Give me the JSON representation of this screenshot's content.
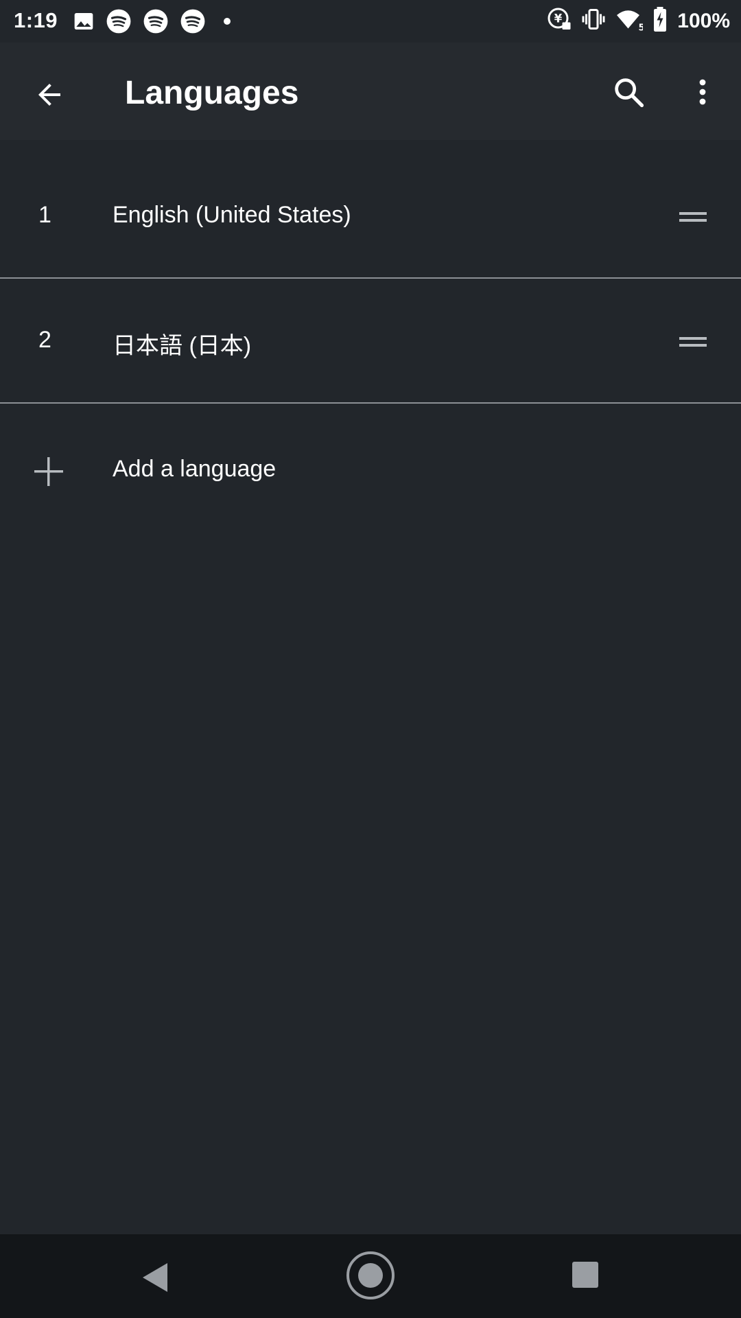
{
  "status_bar": {
    "time": "1:19",
    "battery": "100%",
    "left_icons": [
      "image-icon",
      "spotify-icon",
      "spotify-icon",
      "spotify-icon",
      "dot-icon"
    ],
    "right_icons": [
      "data-saver-icon",
      "vibrate-icon",
      "wifi-icon",
      "battery-charging-icon"
    ]
  },
  "app_bar": {
    "title": "Languages",
    "back_icon": "arrow-back-icon",
    "search_icon": "search-icon",
    "more_icon": "more-vert-icon"
  },
  "languages": [
    {
      "number": "1",
      "name": "English (United States)"
    },
    {
      "number": "2",
      "name": "日本語 (日本)"
    }
  ],
  "add_language": {
    "label": "Add a language",
    "icon": "plus-icon"
  },
  "nav_bar": {
    "icons": [
      "nav-back-icon",
      "nav-home-icon",
      "nav-recents-icon"
    ]
  },
  "colors": {
    "background": "#22262b",
    "app_bar": "#262a2f",
    "nav_bar": "#131619",
    "divider": "#8c9095",
    "text": "#ffffff"
  }
}
